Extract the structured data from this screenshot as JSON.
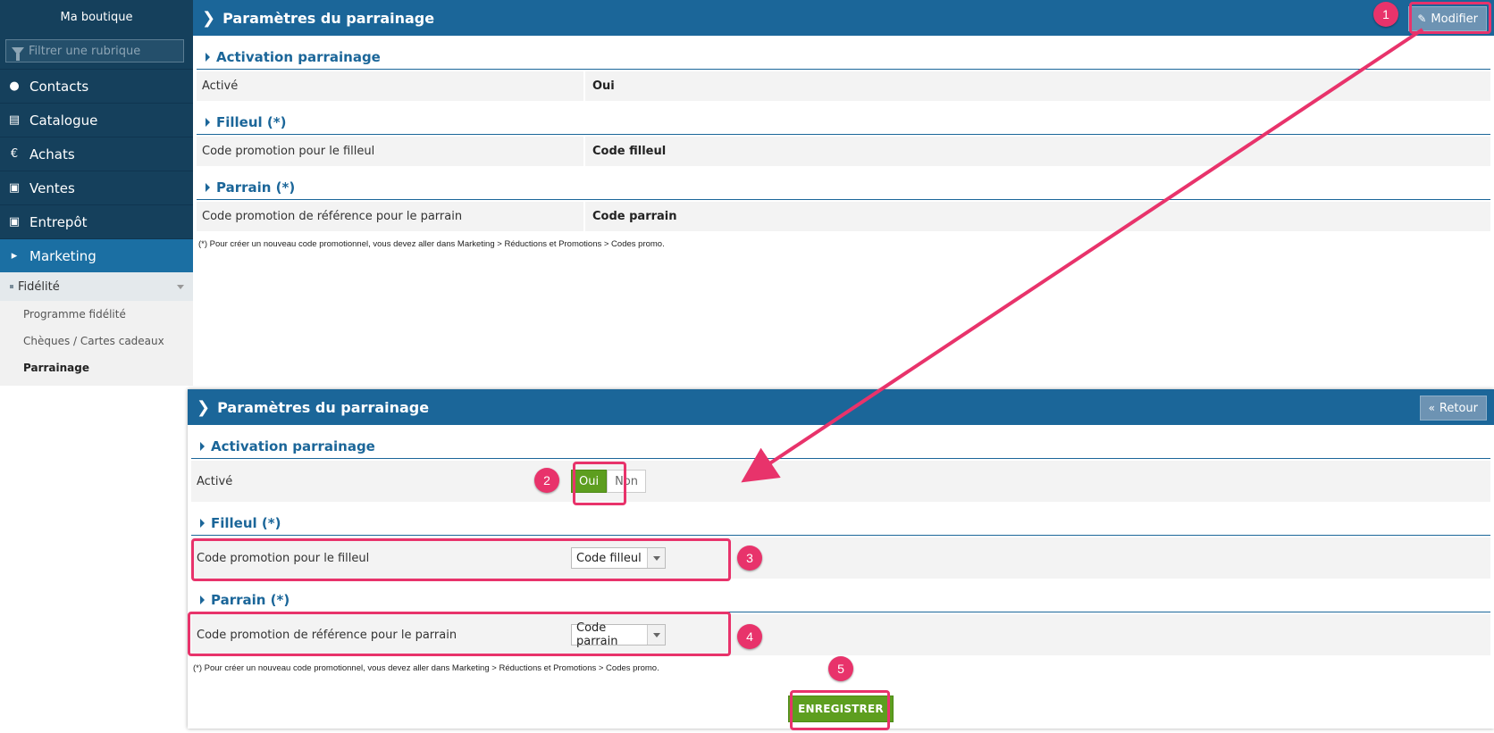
{
  "sidebar": {
    "title": "Ma boutique",
    "filter_placeholder": "Filtrer une rubrique",
    "items": [
      {
        "label": "Contacts",
        "icon": "user-icon"
      },
      {
        "label": "Catalogue",
        "icon": "book-icon"
      },
      {
        "label": "Achats",
        "icon": "euro-icon"
      },
      {
        "label": "Ventes",
        "icon": "cart-icon"
      },
      {
        "label": "Entrepôt",
        "icon": "archive-icon"
      },
      {
        "label": "Marketing",
        "icon": "megaphone-icon"
      }
    ],
    "group": "Fidélité",
    "links": [
      "Programme fidélité",
      "Chèques / Cartes cadeaux",
      "Parrainage"
    ]
  },
  "view_panel": {
    "title": "Paramètres du parrainage",
    "edit_button": "Modifier",
    "sections": [
      {
        "title": "Activation parrainage",
        "label": "Activé",
        "value": "Oui"
      },
      {
        "title": "Filleul (*)",
        "label": "Code promotion pour le filleul",
        "value": "Code filleul"
      },
      {
        "title": "Parrain (*)",
        "label": "Code promotion de référence pour le parrain",
        "value": "Code parrain"
      }
    ],
    "note": "(*) Pour créer un nouveau code promotionnel, vous devez aller dans Marketing > Réductions et Promotions > Codes promo."
  },
  "edit_panel": {
    "title": "Paramètres du parrainage",
    "back_button": "Retour",
    "sections": [
      {
        "title": "Activation parrainage",
        "label": "Activé",
        "toggle_on": "Oui",
        "toggle_off": "Non"
      },
      {
        "title": "Filleul (*)",
        "label": "Code promotion pour le filleul",
        "select_value": "Code filleul"
      },
      {
        "title": "Parrain (*)",
        "label": "Code promotion de référence pour le parrain",
        "select_value": "Code parrain"
      }
    ],
    "note": "(*) Pour créer un nouveau code promotionnel, vous devez aller dans Marketing > Réductions et Promotions > Codes promo.",
    "save_button": "ENREGISTRER"
  },
  "annotations": {
    "badges": [
      "1",
      "2",
      "3",
      "4",
      "5"
    ],
    "color": "#e8336b"
  },
  "colors": {
    "sidebar_bg": "#15405c",
    "header_bg": "#1b6699",
    "active_item": "#1b6fa3",
    "success": "#5d9e1f"
  }
}
